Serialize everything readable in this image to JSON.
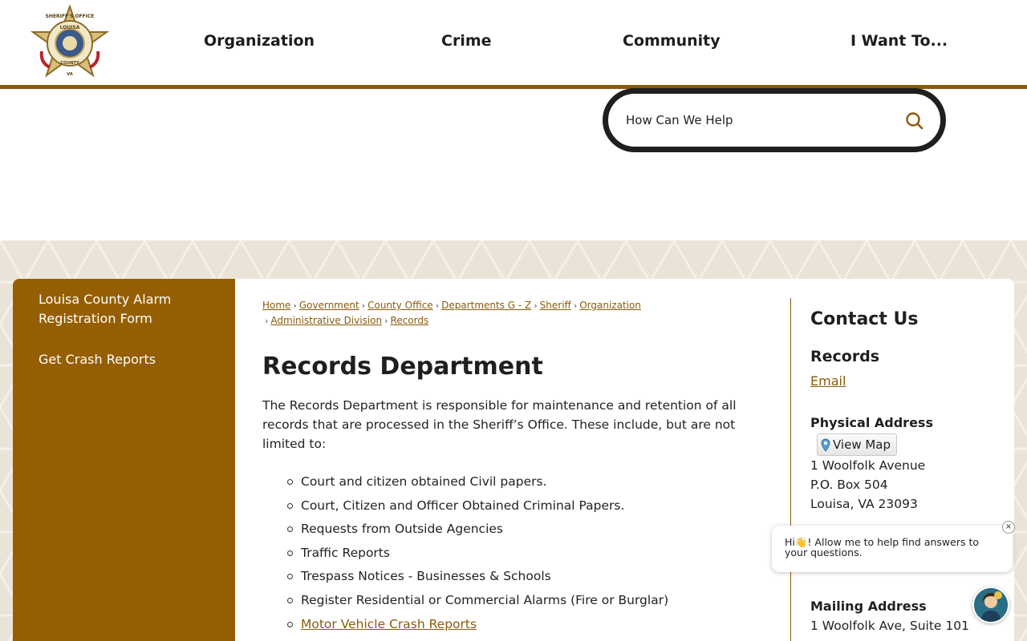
{
  "header": {
    "logo_text_top": "SHERIFF'S OFFICE",
    "logo_text_county": "LOUISA",
    "logo_text_bottom": "COUNTY",
    "logo_text_state": "VA",
    "nav": [
      {
        "label": "Organization"
      },
      {
        "label": "Crime"
      },
      {
        "label": "Community"
      },
      {
        "label": "I Want To..."
      }
    ]
  },
  "search": {
    "placeholder": "How Can We Help"
  },
  "sidebar": {
    "items": [
      {
        "label": "Louisa County Alarm Registration Form"
      },
      {
        "label": "Get Crash Reports"
      }
    ]
  },
  "breadcrumb": [
    "Home",
    "Government",
    "County Office",
    "Departments G - Z",
    "Sheriff",
    "Organization",
    "Administrative Division",
    "Records"
  ],
  "main": {
    "title": "Records Department",
    "intro": "The Records Department is responsible for maintenance and retention of all records that are processed in the Sheriff’s Office. These include, but are not limited to:",
    "list": [
      "Court and citizen obtained Civil papers.",
      "Court, Citizen and Officer Obtained Criminal Papers.",
      "Requests from Outside Agencies",
      "Traffic Reports",
      "Trespass Notices - Businesses & Schools",
      "Register Residential or Commercial Alarms (Fire or Burglar)"
    ],
    "list_link": "Motor Vehicle Crash Reports"
  },
  "contact": {
    "title": "Contact Us",
    "department": "Records",
    "email_label": "Email",
    "physical_label": "Physical Address",
    "view_map_label": "View Map",
    "physical_lines": [
      "1 Woolfolk Avenue",
      "P.O. Box 504",
      "Louisa, VA 23093"
    ],
    "mailing_label": "Mailing Address",
    "mailing_lines": [
      "1 Woolfolk Ave, Suite 101"
    ]
  },
  "chat": {
    "message": "Hi👋! Allow me to help find answers to your questions.",
    "close_label": "×"
  },
  "colors": {
    "brand_brown": "#955e02",
    "link_brown": "#8a5a0b",
    "pattern_bg": "#ece3d8"
  }
}
